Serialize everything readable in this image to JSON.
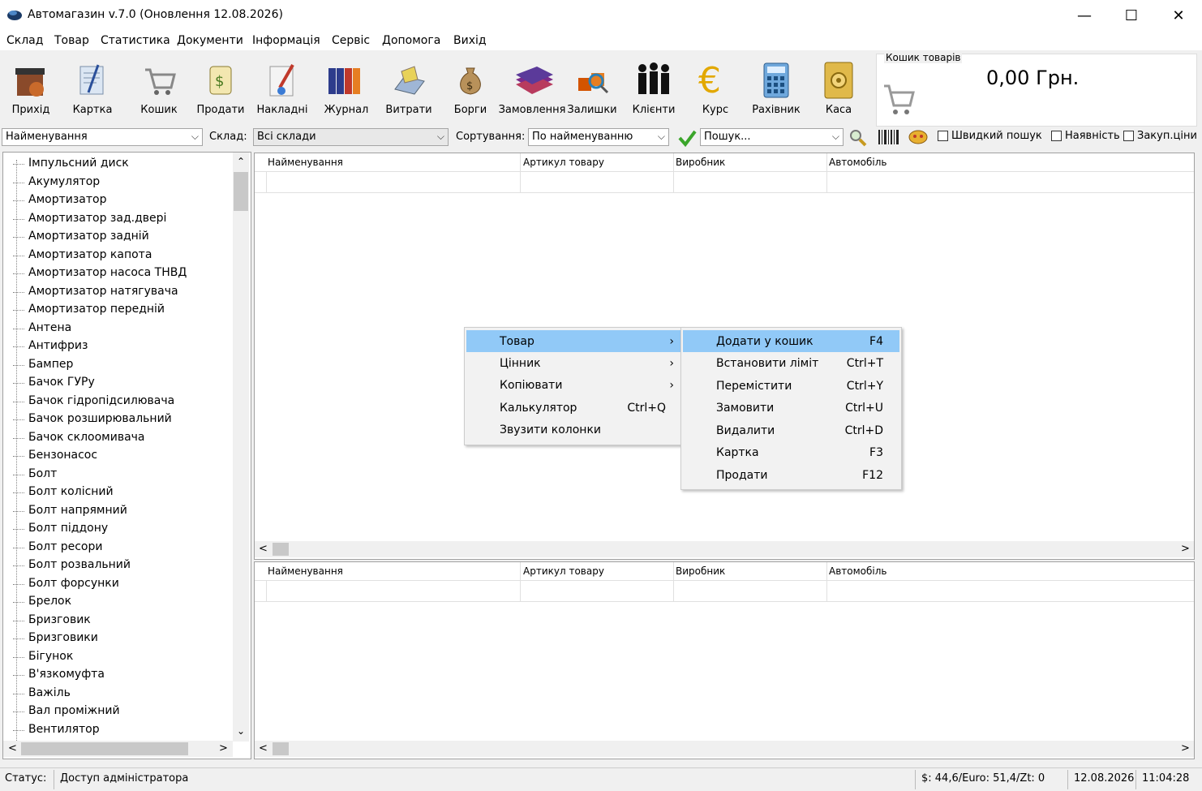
{
  "window": {
    "title": "Автомагазин v.7.0 (Оновлення 12.08.2026)",
    "minimize": "—",
    "maximize": "☐",
    "close": "✕"
  },
  "menu": [
    "Склад",
    "Товар",
    "Статистика",
    "Документи",
    "Інформація",
    "Сервіс",
    "Допомога",
    "Вихід"
  ],
  "toolbar": [
    {
      "label": "Прихід",
      "icon": "warehouse-icon"
    },
    {
      "label": "Картка",
      "icon": "card-icon"
    },
    {
      "label": "Кошик",
      "icon": "cart-icon"
    },
    {
      "label": "Продати",
      "icon": "sell-icon"
    },
    {
      "label": "Накладні",
      "icon": "invoice-icon"
    },
    {
      "label": "Журнал",
      "icon": "journal-icon"
    },
    {
      "label": "Витрати",
      "icon": "expenses-icon"
    },
    {
      "label": "Борги",
      "icon": "money-bag-icon"
    },
    {
      "label": "Замовлення",
      "icon": "books-icon"
    },
    {
      "label": "Залишки",
      "icon": "boxes-icon"
    },
    {
      "label": "Клієнти",
      "icon": "clients-icon"
    },
    {
      "label": "Курс",
      "icon": "euro-icon"
    },
    {
      "label": "Рахівник",
      "icon": "calculator-icon"
    },
    {
      "label": "Каса",
      "icon": "safe-icon"
    }
  ],
  "cart": {
    "title": "Кошик товарів",
    "amount": "0,00 Грн."
  },
  "filters": {
    "search_by": "Найменування",
    "warehouse_label": "Склад:",
    "warehouse": "Всі склади",
    "sort_label": "Сортування:",
    "sort": "По найменуванню",
    "search_placeholder": "Пошук...",
    "quick_search": "Швидкий пошук",
    "availability": "Наявність",
    "purchase_prices": "Закуп.ціни"
  },
  "tree": [
    "Імпульсний диск",
    "Акумулятор",
    "Амортизатор",
    "Амортизатор зад.двері",
    "Амортизатор задній",
    "Амортизатор капота",
    "Амортизатор насоса ТНВД",
    "Амортизатор натягувача",
    "Амортизатор передній",
    "Антена",
    "Антифриз",
    "Бампер",
    "Бачок ГУРу",
    "Бачок гідропідсилювача",
    "Бачок розширювальний",
    "Бачок склоомивача",
    "Бензонасос",
    "Болт",
    "Болт колісний",
    "Болт напрямний",
    "Болт піддону",
    "Болт ресори",
    "Болт розвальний",
    "Болт форсунки",
    "Брелок",
    "Бризговик",
    "Бризговики",
    "Бігунок",
    "В'язкомуфта",
    "Важіль",
    "Вал проміжний",
    "Вентилятор"
  ],
  "grid_columns": [
    "Найменування",
    "Артикул товару",
    "Виробник",
    "Автомобіль"
  ],
  "context_menu": [
    {
      "label": "Товар",
      "shortcut": "›",
      "highlighted": true
    },
    {
      "label": "Цінник",
      "shortcut": "›"
    },
    {
      "label": "Копіювати",
      "shortcut": "›"
    },
    {
      "label": "Калькулятор",
      "shortcut": "Ctrl+Q"
    },
    {
      "label": "Звузити колонки",
      "shortcut": ""
    }
  ],
  "submenu": [
    {
      "label": "Додати у кошик",
      "shortcut": "F4",
      "highlighted": true
    },
    {
      "label": "Встановити ліміт",
      "shortcut": "Ctrl+T"
    },
    {
      "label": "Перемістити",
      "shortcut": "Ctrl+Y"
    },
    {
      "label": "Замовити",
      "shortcut": "Ctrl+U"
    },
    {
      "label": "Видалити",
      "shortcut": "Ctrl+D"
    },
    {
      "label": "Картка",
      "shortcut": "F3"
    },
    {
      "label": "Продати",
      "shortcut": "F12"
    }
  ],
  "status": {
    "label": "Статус:",
    "value": "Доступ адміністратора",
    "rates": "$: 44,6/Euro: 51,4/Zt: 0",
    "date": "12.08.2026",
    "time": "11:04:28"
  }
}
